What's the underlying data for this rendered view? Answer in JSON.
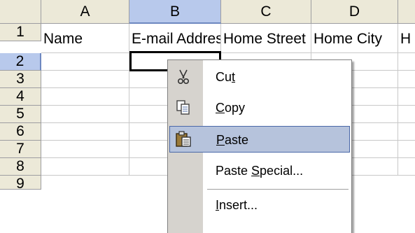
{
  "columns": [
    "A",
    "B",
    "C",
    "D",
    "H"
  ],
  "rows": [
    "1",
    "2",
    "3",
    "4",
    "5",
    "6",
    "7",
    "8",
    "9"
  ],
  "row1": [
    "Name",
    "E-mail Address",
    "Home Street",
    "Home City",
    "H"
  ],
  "context_menu": {
    "items": [
      {
        "label": "Cut",
        "icon": "scissors-icon",
        "mnemonic": "t"
      },
      {
        "label": "Copy",
        "icon": "copy-icon",
        "mnemonic": "C"
      },
      {
        "label": "Paste",
        "icon": "paste-icon",
        "mnemonic": "P",
        "highlighted": true
      },
      {
        "label": "Paste Special...",
        "icon": "",
        "mnemonic": "S"
      },
      {
        "label": "Insert...",
        "icon": "",
        "mnemonic": "I"
      }
    ]
  },
  "colors": {
    "header_bg": "#ece9d8",
    "selected_header": "#b8c9ec",
    "menu_highlight": "#b6c3dc",
    "menu_gutter": "#d6d3ce"
  }
}
